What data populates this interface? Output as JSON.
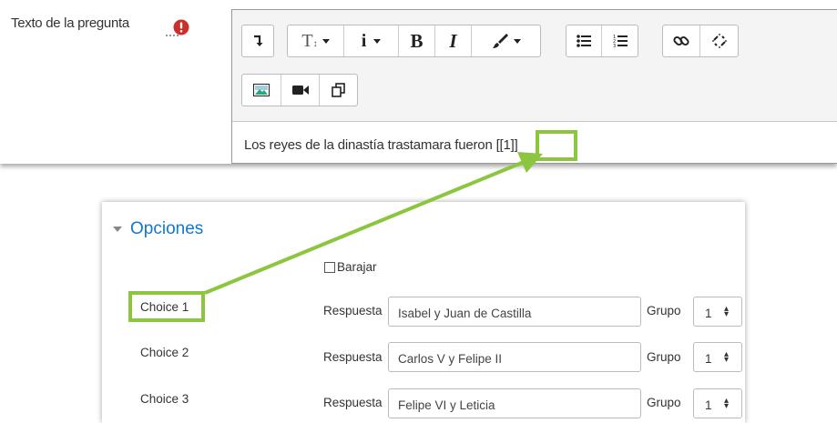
{
  "question": {
    "label": "Texto de la pregunta",
    "required_icon": "exclamation-circle-icon",
    "text": "Los reyes de la dinastía trastamara fueron ",
    "placeholder_token": "[[1]]"
  },
  "toolbar": {
    "row1_icons": [
      "collapse-toggle-icon",
      "text-style-icon",
      "info-icon",
      "bold-icon",
      "italic-icon",
      "text-color-icon",
      "unordered-list-icon",
      "ordered-list-icon",
      "link-icon",
      "unlink-icon"
    ],
    "row2_icons": [
      "insert-image-icon",
      "insert-media-icon",
      "manage-files-icon"
    ],
    "bold_glyph": "B",
    "italic_glyph": "I",
    "info_glyph": "i",
    "style_glyph": "T"
  },
  "options": {
    "title": "Opciones",
    "shuffle_label": "Barajar",
    "shuffle_checked": false,
    "choices": [
      {
        "label": "Choice 1",
        "answer_label": "Respuesta",
        "answer": "Isabel y Juan de Castilla",
        "group_label": "Grupo",
        "group": "1"
      },
      {
        "label": "Choice 2",
        "answer_label": "Respuesta",
        "answer": "Carlos V y Felipe II",
        "group_label": "Grupo",
        "group": "1"
      },
      {
        "label": "Choice 3",
        "answer_label": "Respuesta",
        "answer": "Felipe VI y Leticia",
        "group_label": "Grupo",
        "group": "1"
      }
    ]
  },
  "colors": {
    "highlight": "#8cc63f",
    "link_blue": "#1177d1",
    "required_red": "#c9302c"
  }
}
